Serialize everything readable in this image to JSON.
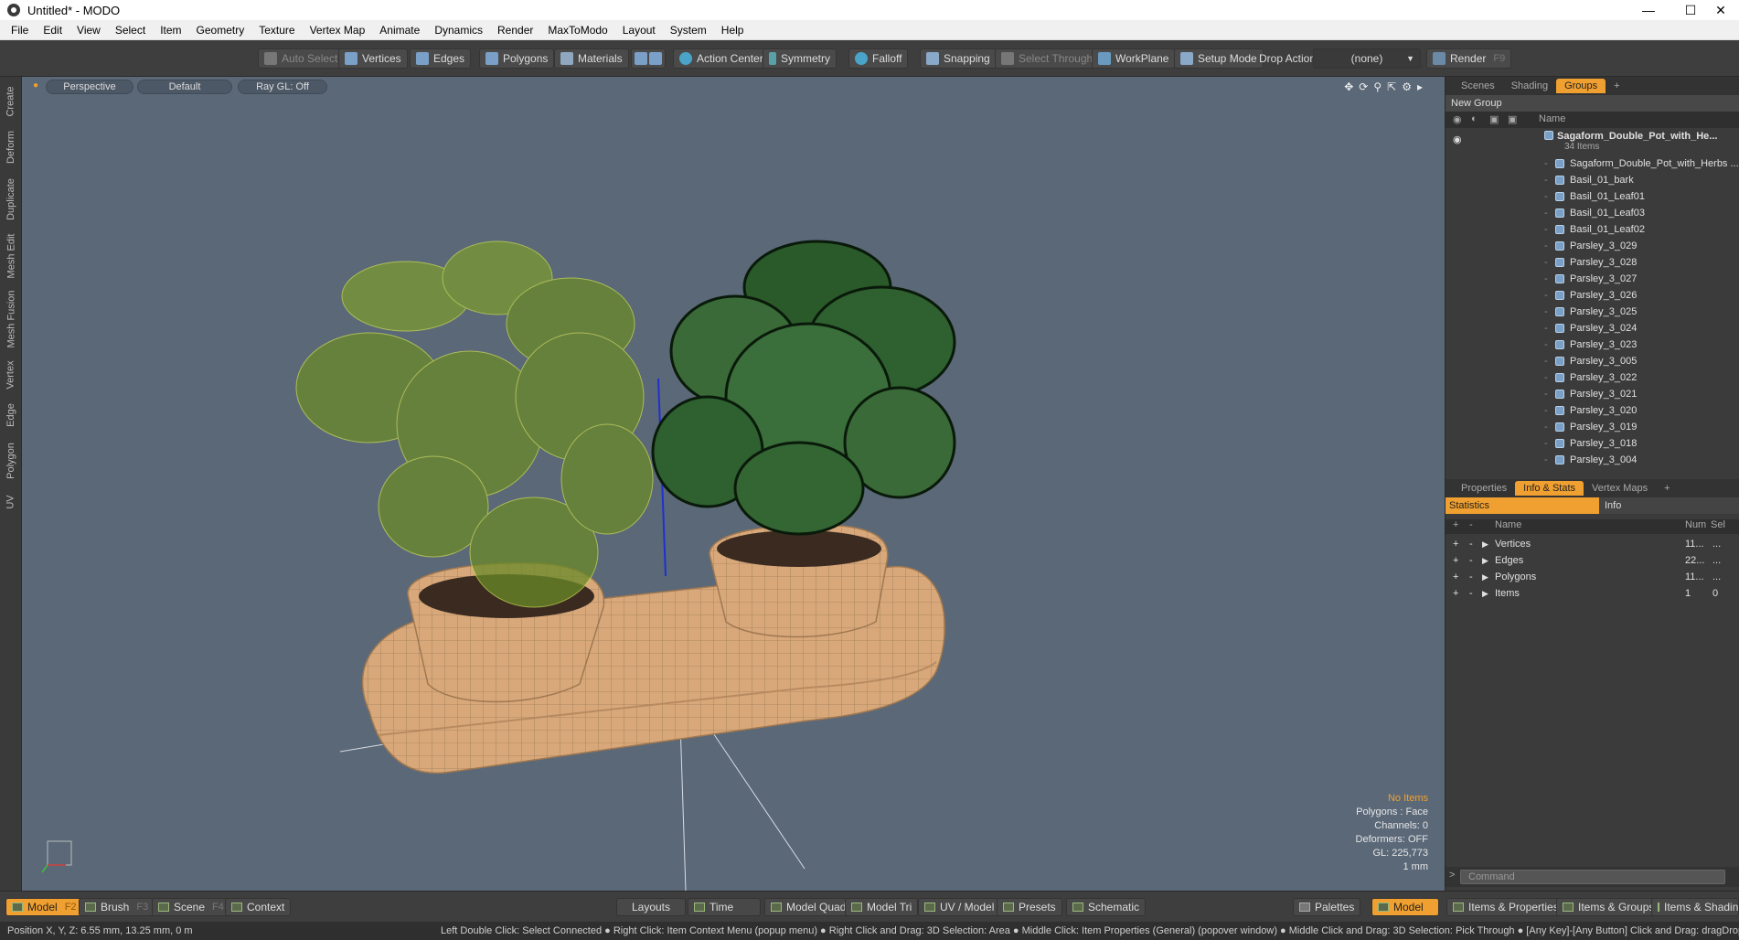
{
  "window": {
    "title": "Untitled* - MODO"
  },
  "menu": [
    "File",
    "Edit",
    "View",
    "Select",
    "Item",
    "Geometry",
    "Texture",
    "Vertex Map",
    "Animate",
    "Dynamics",
    "Render",
    "MaxToModo",
    "Layout",
    "System",
    "Help"
  ],
  "toolbar": {
    "auto_select": "Auto Select",
    "vertices": "Vertices",
    "edges": "Edges",
    "polygons": "Polygons",
    "materials": "Materials",
    "action_center": "Action Center",
    "symmetry": "Symmetry",
    "falloff": "Falloff",
    "snapping": "Snapping",
    "select_through": "Select Through",
    "workplane": "WorkPlane",
    "setup_mode": "Setup Mode",
    "drop_action_label": "Drop Action",
    "drop_action_value": "(none)",
    "render": "Render",
    "render_key": "F9"
  },
  "left_tabs": [
    "Create",
    "Deform",
    "Duplicate",
    "Mesh Edit",
    "Mesh Fusion",
    "Vertex",
    "Edge",
    "Polygon",
    "UV"
  ],
  "viewport": {
    "view": "Perspective",
    "shading": "Default",
    "raygl": "Ray GL: Off",
    "info": {
      "no_items": "No Items",
      "polygons": "Polygons : Face",
      "channels": "Channels: 0",
      "deformers": "Deformers: OFF",
      "gl": "GL: 225,773",
      "scale": "1 mm"
    }
  },
  "scene_panel": {
    "tabs": [
      "Scenes",
      "Shading",
      "Groups"
    ],
    "active_tab": "Groups",
    "new_group": "New Group",
    "name_col": "Name",
    "root": {
      "name": "Sagaform_Double_Pot_with_He...",
      "count": "34 Items"
    },
    "items": [
      "Sagaform_Double_Pot_with_Herbs ...",
      "Basil_01_bark",
      "Basil_01_Leaf01",
      "Basil_01_Leaf03",
      "Basil_01_Leaf02",
      "Parsley_3_029",
      "Parsley_3_028",
      "Parsley_3_027",
      "Parsley_3_026",
      "Parsley_3_025",
      "Parsley_3_024",
      "Parsley_3_023",
      "Parsley_3_005",
      "Parsley_3_022",
      "Parsley_3_021",
      "Parsley_3_020",
      "Parsley_3_019",
      "Parsley_3_018",
      "Parsley_3_004"
    ]
  },
  "stats_panel": {
    "tabs": [
      "Properties",
      "Info & Stats",
      "Vertex Maps"
    ],
    "active_tab": "Info & Stats",
    "subtabs": [
      "Statistics",
      "Info"
    ],
    "cols": {
      "name": "Name",
      "num": "Num",
      "sel": "Sel"
    },
    "rows": [
      {
        "name": "Vertices",
        "num": "11...",
        "sel": "..."
      },
      {
        "name": "Edges",
        "num": "22...",
        "sel": "..."
      },
      {
        "name": "Polygons",
        "num": "11...",
        "sel": "..."
      },
      {
        "name": "Items",
        "num": "1",
        "sel": "0"
      }
    ],
    "command_placeholder": "Command"
  },
  "bottom": {
    "model": "Model",
    "model_key": "F2",
    "brush": "Brush",
    "brush_key": "F3",
    "scene": "Scene",
    "scene_key": "F4",
    "context": "Context",
    "layouts": "Layouts",
    "time": "Time",
    "model_quad": "Model Quad",
    "model_tri": "Model Tri",
    "uv_model": "UV / Model",
    "presets": "Presets",
    "schematic": "Schematic",
    "palettes": "Palettes",
    "model_right": "Model",
    "items_props": "Items & Properties",
    "items_groups": "Items & Groups",
    "items_shading": "Items & Shadin"
  },
  "status": {
    "position": "Position X, Y, Z:  6.55 mm, 13.25 mm, 0 m",
    "hints": "Left Double Click: Select Connected ● Right Click: Item Context Menu (popup menu) ● Right Click and Drag: 3D Selection: Area ● Middle Click: Item Properties (General) (popover window) ● Middle Click and Drag: 3D Selection: Pick Through ● [Any Key]-[Any Button] Click and Drag: dragDrop"
  },
  "colors": {
    "accent": "#f0a030",
    "viewport_bg": "#5a6878",
    "panel_bg": "#3b3b3b"
  }
}
